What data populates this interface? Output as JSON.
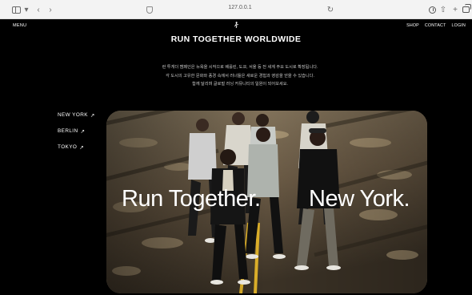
{
  "browser": {
    "url": "127.0.0.1",
    "icons": [
      "sidebar-icon",
      "chevron-down-icon",
      "back-icon",
      "forward-icon",
      "shield-icon",
      "reload-icon",
      "download-icon",
      "share-icon",
      "plus-icon",
      "tabs-icon"
    ]
  },
  "header": {
    "menu": "MENU",
    "nav": {
      "shop": "SHOP",
      "contact": "CONTACT",
      "login": "LOGIN"
    }
  },
  "page": {
    "title": "RUN TOGETHER WORLDWIDE",
    "intro": [
      "런 투게더 캠페인은 뉴욕을 시작으로 베를린, 도쿄, 서울 등 전 세계 주요 도시로 확장됩니다.",
      "각 도시의 고유한 문화와 풍경 속에서 러너들은 새로운 경험과 영감을 얻을 수 있습니다.",
      "함께 달리며 글로벌 러닝 커뮤니티의 일원이 되어보세요."
    ]
  },
  "cities": [
    {
      "label": "NEW YORK",
      "arrow": "↗"
    },
    {
      "label": "BERLIN",
      "arrow": "↗"
    },
    {
      "label": "TOKYO",
      "arrow": "↗"
    }
  ],
  "hero": {
    "left_text": "Run Together.",
    "right_text": "New York."
  }
}
